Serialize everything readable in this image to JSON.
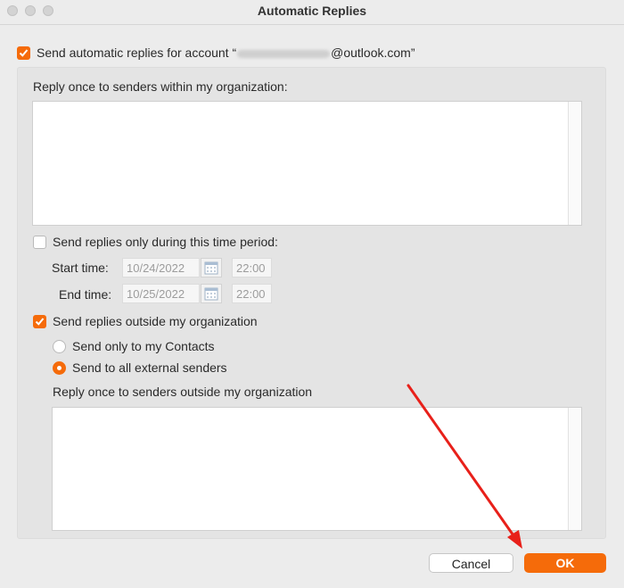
{
  "window": {
    "title": "Automatic Replies"
  },
  "account": {
    "prefix": "Send automatic replies for account “",
    "suffix": "@outlook.com”",
    "checked": true
  },
  "internal": {
    "label": "Reply once to senders within my organization:",
    "message": ""
  },
  "time_period": {
    "label": "Send replies only during this time period:",
    "checked": false,
    "start_label": "Start time:",
    "start_date": "10/24/2022",
    "start_time": "22:00",
    "end_label": "End time:",
    "end_date": "10/25/2022",
    "end_time": "22:00"
  },
  "external": {
    "label": "Send replies outside my organization",
    "checked": true,
    "option_contacts": "Send only to my Contacts",
    "option_all": "Send to all external senders",
    "selected": "Send to all external senders",
    "message_label": "Reply once to senders outside my organization",
    "message": ""
  },
  "buttons": {
    "cancel": "Cancel",
    "ok": "OK"
  },
  "colors": {
    "accent": "#f56b0a",
    "annotation_arrow": "#e8201a"
  },
  "icons": {
    "calendar": "calendar-icon",
    "check": "checkmark-icon"
  }
}
